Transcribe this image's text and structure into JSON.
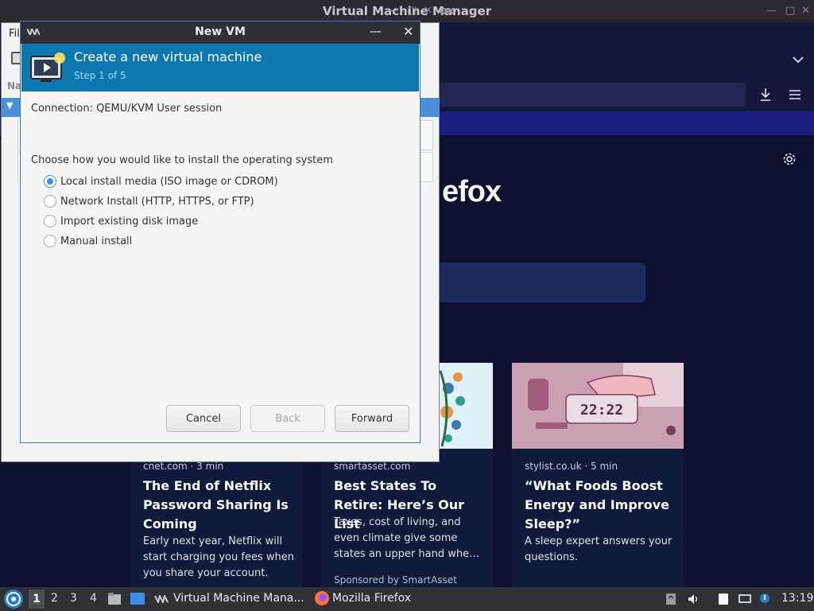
{
  "firefox": {
    "window_title": "Virtual Machine Manager",
    "window_title_right": "ox",
    "logo_text": "efox",
    "cards": [
      {
        "meta": "cnet.com · 3 min",
        "title": "The End of Netflix Password Sharing Is Coming",
        "desc": "Early next year, Netflix will start charging you fees when you share your account.",
        "sponsor": ""
      },
      {
        "meta": "smartasset.com",
        "title": "Best States To Retire: Here’s Our List",
        "desc": "Taxes, cost of living, and even climate give some states an upper hand whe…",
        "sponsor": "Sponsored by SmartAsset"
      },
      {
        "meta": "stylist.co.uk · 5 min",
        "title": "“What Foods Boost Energy and Improve Sleep?”",
        "desc": "A sleep expert answers your questions.",
        "sponsor": "",
        "clock": "22:22"
      }
    ]
  },
  "vmm": {
    "menu_file": "Fil",
    "column_header": "Na"
  },
  "dialog": {
    "title": "New VM",
    "heading": "Create a new virtual machine",
    "step": "Step 1 of 5",
    "connection": "Connection:  QEMU/KVM User session",
    "prompt": "Choose how you would like to install the operating system",
    "options": [
      {
        "label": "Local install media (ISO image or CDROM)",
        "checked": true
      },
      {
        "label": "Network Install (HTTP, HTTPS, or FTP)",
        "checked": false
      },
      {
        "label": "Import existing disk image",
        "checked": false
      },
      {
        "label": "Manual install",
        "checked": false
      }
    ],
    "buttons": {
      "cancel": "Cancel",
      "back": "Back",
      "forward": "Forward"
    }
  },
  "taskbar": {
    "workspaces": [
      "1",
      "2",
      "3",
      "4"
    ],
    "tasks": [
      {
        "label": "Virtual Machine Mana..."
      },
      {
        "label": "Mozilla Firefox"
      }
    ],
    "time": "13:19"
  },
  "colors": {
    "accent": "#0d78b0",
    "selection": "#4a90d9",
    "radio_checked": "#3f8ae2"
  }
}
